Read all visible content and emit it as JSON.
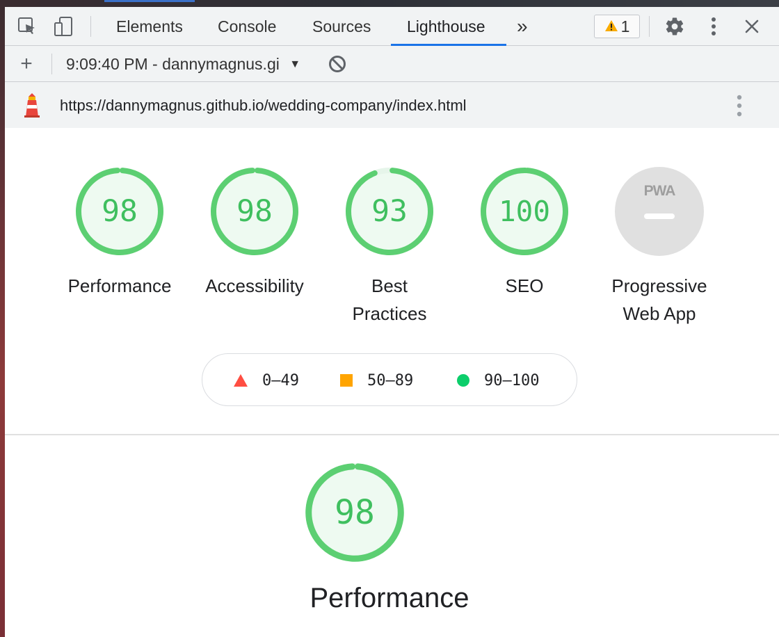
{
  "toolbar": {
    "tabs": [
      {
        "label": "Elements"
      },
      {
        "label": "Console"
      },
      {
        "label": "Sources"
      },
      {
        "label": "Lighthouse"
      }
    ],
    "more_tabs_glyph": "»",
    "warning_count": "1",
    "icons": [
      "inspect-element-icon",
      "device-toolbar-icon",
      "warning-icon",
      "settings-gear-icon",
      "kebab-menu-icon",
      "close-icon"
    ]
  },
  "report_bar": {
    "new_report_glyph": "+",
    "selected_report": "9:09:40 PM - dannymagnus.gi",
    "dropdown_glyph": "▼"
  },
  "url_bar": {
    "url": "https://dannymagnus.github.io/wedding-company/index.html"
  },
  "scores": [
    {
      "score": "98",
      "label": "Performance"
    },
    {
      "score": "98",
      "label": "Accessibility"
    },
    {
      "score": "93",
      "label_lines": [
        "Best",
        "Practices"
      ]
    },
    {
      "score": "100",
      "label": "SEO"
    },
    {
      "badge": "PWA",
      "label_lines": [
        "Progressive",
        "Web App"
      ]
    }
  ],
  "score_fractions": [
    0.98,
    0.98,
    0.93,
    1.0
  ],
  "legend": {
    "fail": "0–49",
    "average": "50–89",
    "pass": "90–100"
  },
  "section": {
    "score": "98",
    "score_fraction": 0.98,
    "title": "Performance"
  },
  "colors": {
    "pass": "#0cce6b",
    "pass_ring": "#5ccf72",
    "pass_fill": "#eefaf1",
    "average": "#ffa400",
    "fail": "#ff4e42",
    "accent": "#1a73e8",
    "pwa_gray": "#e0e0e0"
  }
}
